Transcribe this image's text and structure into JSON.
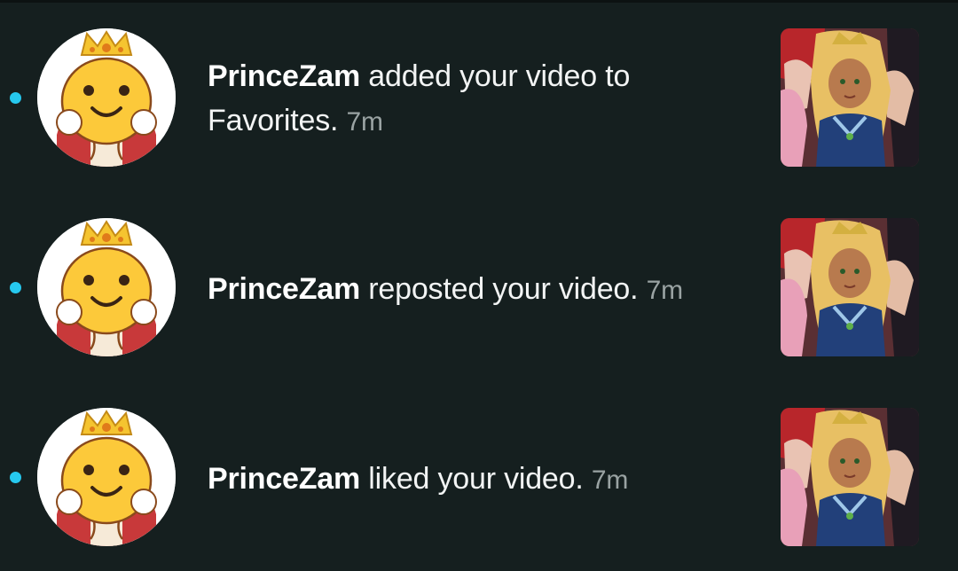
{
  "notifications": [
    {
      "user": "PrinceZam",
      "action": " added your video to Favorites.",
      "time": "7m",
      "unread": true,
      "avatar_icon": "crowned-smiley-mascot-icon",
      "thumbnail": "video-thumbnail-anime-art"
    },
    {
      "user": "PrinceZam",
      "action": " reposted your video.",
      "time": "7m",
      "unread": true,
      "avatar_icon": "crowned-smiley-mascot-icon",
      "thumbnail": "video-thumbnail-anime-art"
    },
    {
      "user": "PrinceZam",
      "action": " liked your video.",
      "time": "7m",
      "unread": true,
      "avatar_icon": "crowned-smiley-mascot-icon",
      "thumbnail": "video-thumbnail-anime-art"
    }
  ],
  "colors": {
    "background": "#151f1f",
    "unread_dot": "#26c8ee",
    "text": "#f2f4f4",
    "timestamp": "#9aa3a3"
  }
}
